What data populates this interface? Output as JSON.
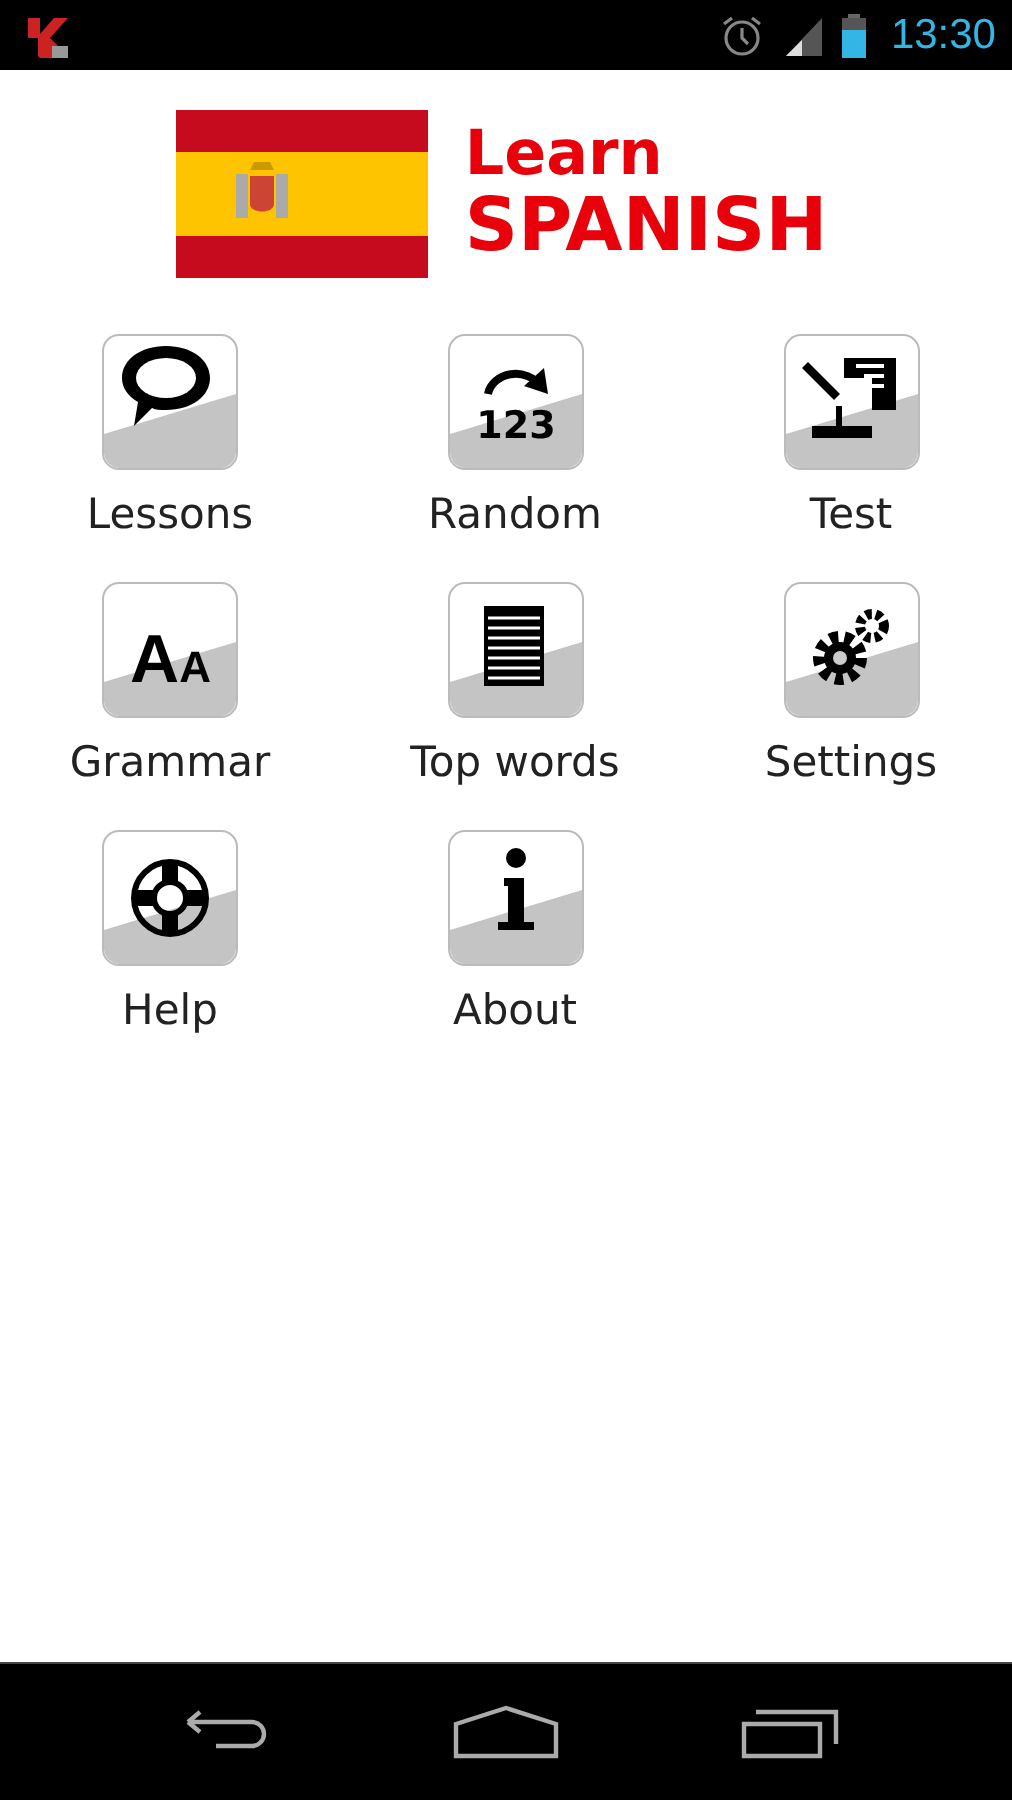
{
  "status_bar": {
    "time": "13:30"
  },
  "header": {
    "line1": "Learn",
    "line2": "SPANISH"
  },
  "menu": [
    {
      "label": "Lessons"
    },
    {
      "label": "Random",
      "icon_text": "123"
    },
    {
      "label": "Test"
    },
    {
      "label": "Grammar",
      "icon_text": "AA"
    },
    {
      "label": "Top words"
    },
    {
      "label": "Settings"
    },
    {
      "label": "Help"
    },
    {
      "label": "About"
    }
  ]
}
